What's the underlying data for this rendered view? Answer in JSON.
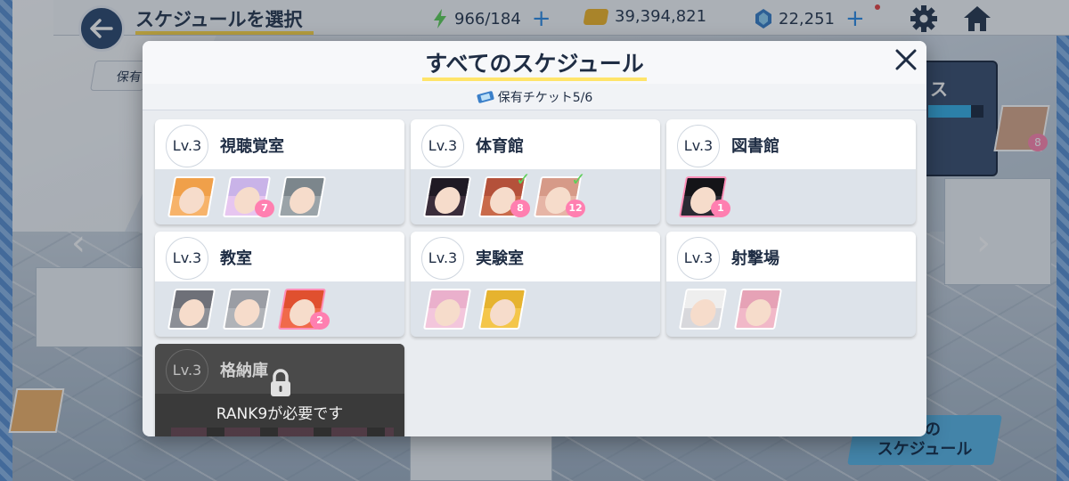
{
  "header": {
    "title": "スケジュールを選択",
    "ap": "966/184",
    "credits": "39,394,821",
    "gems": "22,251",
    "plus": "+"
  },
  "background": {
    "ticket_chip_label": "保有",
    "side_panel_label": "ス",
    "side_panel_bar_fill": 0.78,
    "side_avatar_badge": "8",
    "all_schedules_button": "すべての\nスケジュール",
    "all_schedules_line1": "ての",
    "all_schedules_line2": "スケジュール"
  },
  "modal": {
    "title": "すべてのスケジュール",
    "close": "✕",
    "ticket_label": "保有チケット5/6"
  },
  "rooms": [
    {
      "level": "Lv.3",
      "name": "視聴覚室"
    },
    {
      "level": "Lv.3",
      "name": "体育館"
    },
    {
      "level": "Lv.3",
      "name": "図書館"
    },
    {
      "level": "Lv.3",
      "name": "教室"
    },
    {
      "level": "Lv.3",
      "name": "実験室"
    },
    {
      "level": "Lv.3",
      "name": "射撃場"
    },
    {
      "level": "Lv.3",
      "name": "格納庫",
      "locked_text": "RANK9が必要です"
    }
  ],
  "badges": {
    "r0_a1": "7",
    "r1_a1": "8",
    "r1_a2": "12",
    "r2_a0": "1",
    "r3_a2": "2"
  },
  "colors": {
    "accent_yellow": "#ffe46a",
    "heart_pink": "#ff7fb0",
    "check_green": "#5fcf5a",
    "plus_blue": "#2f8ce6"
  }
}
